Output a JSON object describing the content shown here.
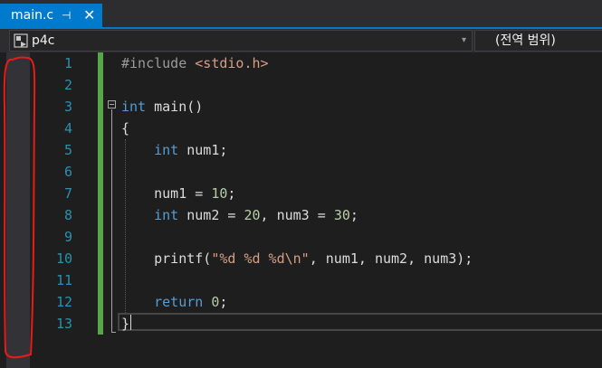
{
  "tab": {
    "title": "main.c",
    "pin_glyph": "⊣",
    "close_glyph": "✕"
  },
  "navbar": {
    "project": "p4c",
    "project_icon": "cpp-project-icon",
    "scope": "(전역 범위)",
    "arrow_glyph": "▾"
  },
  "editor": {
    "line_numbers": [
      "1",
      "2",
      "3",
      "4",
      "5",
      "6",
      "7",
      "8",
      "9",
      "10",
      "11",
      "12",
      "13"
    ],
    "lines": [
      [
        {
          "t": "#include ",
          "c": "pp"
        },
        {
          "t": "<stdio.h>",
          "c": "inc"
        }
      ],
      [],
      [
        {
          "t": "int",
          "c": "kw"
        },
        {
          "t": " main()",
          "c": "plain"
        }
      ],
      [
        {
          "t": "{",
          "c": "plain"
        }
      ],
      [
        {
          "t": "    ",
          "c": "plain"
        },
        {
          "t": "int",
          "c": "kw"
        },
        {
          "t": " num1;",
          "c": "plain"
        }
      ],
      [],
      [
        {
          "t": "    num1 = ",
          "c": "plain"
        },
        {
          "t": "10",
          "c": "num"
        },
        {
          "t": ";",
          "c": "plain"
        }
      ],
      [
        {
          "t": "    ",
          "c": "plain"
        },
        {
          "t": "int",
          "c": "kw"
        },
        {
          "t": " num2 = ",
          "c": "plain"
        },
        {
          "t": "20",
          "c": "num"
        },
        {
          "t": ", num3 = ",
          "c": "plain"
        },
        {
          "t": "30",
          "c": "num"
        },
        {
          "t": ";",
          "c": "plain"
        }
      ],
      [],
      [
        {
          "t": "    printf(",
          "c": "plain"
        },
        {
          "t": "\"%d %d %d\\n\"",
          "c": "str"
        },
        {
          "t": ", num1, num2, num3);",
          "c": "plain"
        }
      ],
      [],
      [
        {
          "t": "    ",
          "c": "plain"
        },
        {
          "t": "return",
          "c": "kw"
        },
        {
          "t": " ",
          "c": "plain"
        },
        {
          "t": "0",
          "c": "num"
        },
        {
          "t": ";",
          "c": "plain"
        }
      ],
      [
        {
          "t": "}",
          "c": "plain"
        }
      ]
    ]
  },
  "colors": {
    "tab_active": "#007acc",
    "keyword": "#569cd6",
    "string": "#d69d85",
    "number": "#b5cea8",
    "line_number": "#2b91af",
    "change_bar": "#57a64a",
    "annotation": "#e81b1b"
  }
}
